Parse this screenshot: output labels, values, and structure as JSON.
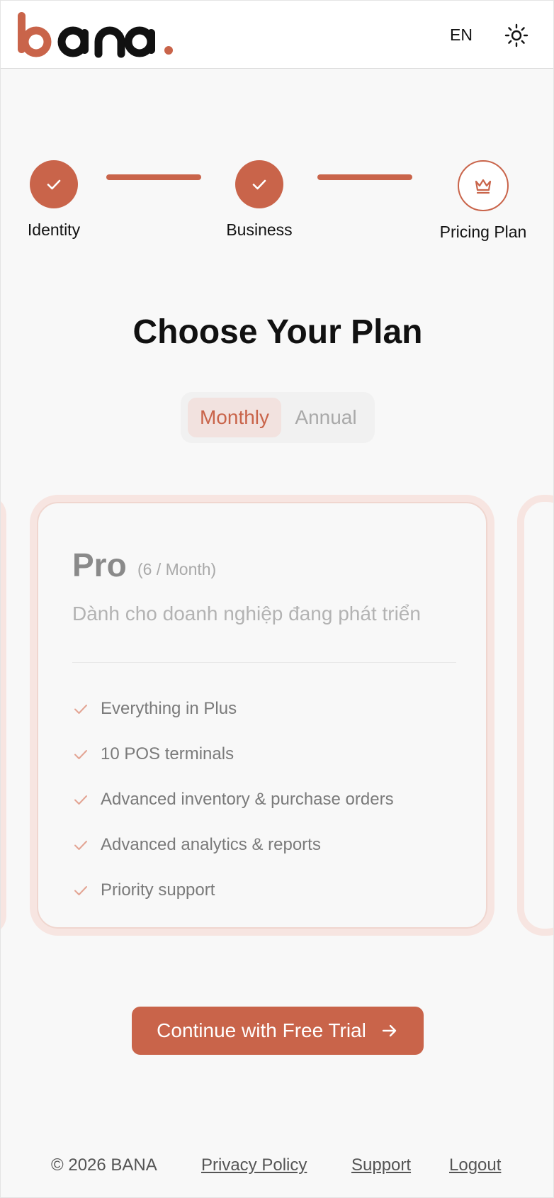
{
  "header": {
    "logo_text": "bana.",
    "language": "EN",
    "theme_icon": "sun-icon"
  },
  "stepper": {
    "steps": [
      {
        "label": "Identity",
        "status": "completed",
        "icon": "check-icon"
      },
      {
        "label": "Business",
        "status": "completed",
        "icon": "check-icon"
      },
      {
        "label": "Pricing Plan",
        "status": "current",
        "icon": "crown-icon"
      }
    ]
  },
  "main": {
    "title": "Choose Your Plan",
    "billing_toggle": {
      "options": [
        "Monthly",
        "Annual"
      ],
      "selected": "Monthly"
    },
    "plan": {
      "name": "Pro",
      "price": "(6 / Month)",
      "description": "Dành cho doanh nghiệp đang phát triển",
      "features": [
        "Everything in Plus",
        "10 POS terminals",
        "Advanced inventory & purchase orders",
        "Advanced analytics & reports",
        "Priority support"
      ]
    },
    "cta_label": "Continue with Free Trial"
  },
  "footer": {
    "copyright": "© 2026 BANA",
    "links": [
      "Privacy Policy",
      "Support",
      "Logout"
    ]
  },
  "colors": {
    "accent": "#c9644a",
    "toggle_active_bg": "#f2e2df",
    "card_border": "#f7e5e1"
  }
}
